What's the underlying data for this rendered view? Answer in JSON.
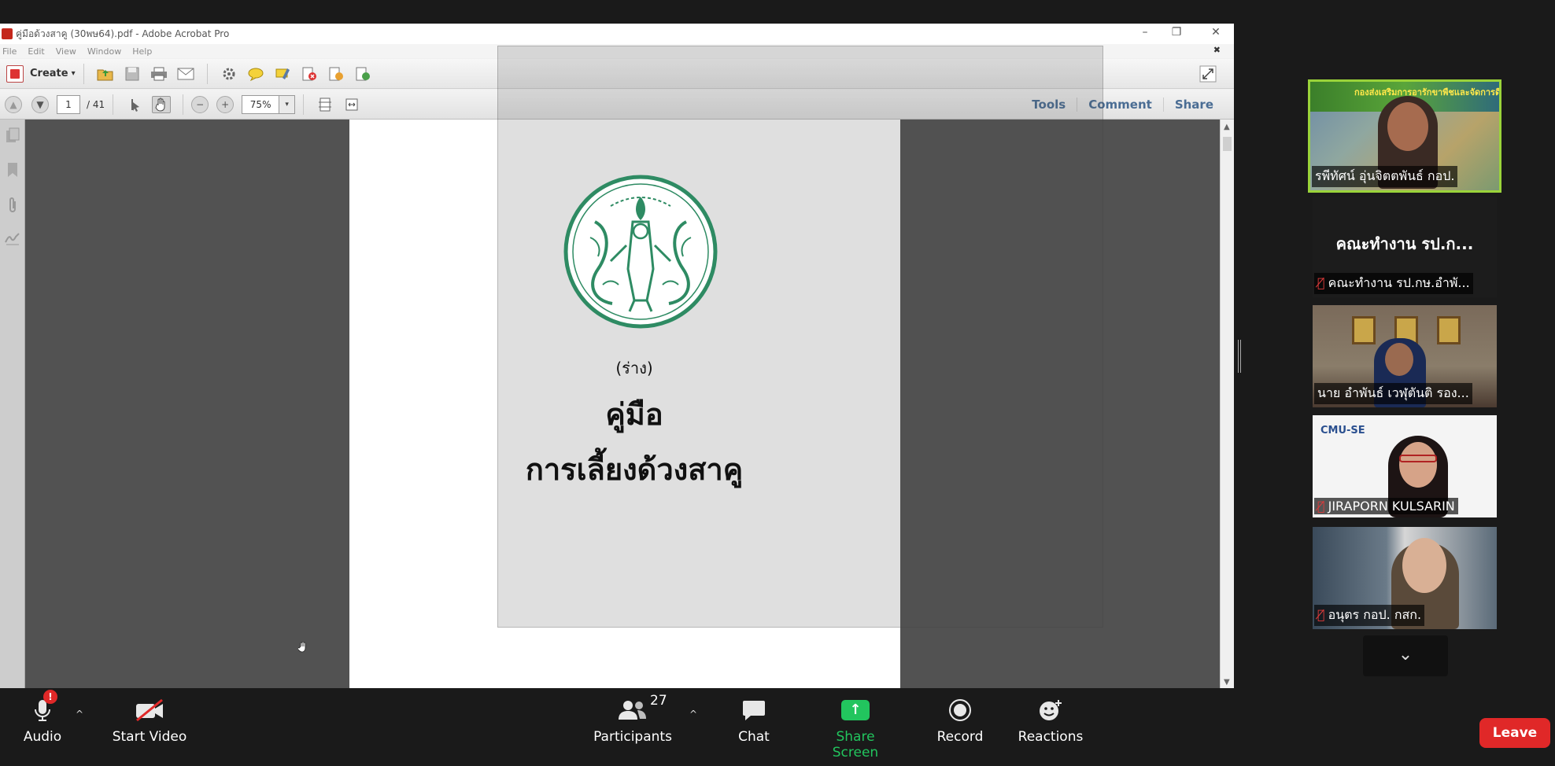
{
  "acrobat": {
    "window_title": "คู่มือด้วงสาคู (30พษ64).pdf - Adobe Acrobat Pro",
    "window_controls": {
      "minimize": "–",
      "restore": "❐",
      "close": "✕"
    },
    "menu": [
      "File",
      "Edit",
      "View",
      "Window",
      "Help"
    ],
    "close_doc": "✖",
    "toolbar": {
      "create_label": "Create",
      "create_caret": "▾"
    },
    "nav": {
      "page_current": "1",
      "page_total": "/ 41",
      "zoom": "75%",
      "zoom_caret": "▾"
    },
    "panels": [
      "Tools",
      "Comment",
      "Share"
    ]
  },
  "document": {
    "draft_label": "(ร่าง)",
    "title_line1": "คู่มือ",
    "title_line2": "การเลี้ยงด้วงสาคู"
  },
  "gallery": {
    "tiles": [
      {
        "name": "รพีทัศน์ อุ่นจิตตพันธ์ กอป.",
        "muted": false,
        "banner_text": "กองส่งเสริมการอารักขาพืชและจัดการดินปุ๋ย",
        "active_speaker": true
      },
      {
        "name": "คณะทำงาน รป.กษ.อำพั...",
        "muted": true,
        "big_name": "คณะทำงาน รป.ก..."
      },
      {
        "name": "นาย อำพันธ์ เวฬุตันติ รอง...",
        "muted": false
      },
      {
        "name": "JIRAPORN KULSARIN",
        "muted": true,
        "logo_text": "CMU-SE"
      },
      {
        "name": "อนุตร กอป. กสก.",
        "muted": true
      }
    ],
    "scroll_down": "⌄"
  },
  "zoom_bar": {
    "audio_label": "Audio",
    "audio_alert": "!",
    "video_label": "Start Video",
    "participants_label": "Participants",
    "participants_count": "27",
    "chat_label": "Chat",
    "share_label": "Share Screen",
    "record_label": "Record",
    "reactions_label": "Reactions",
    "leave_label": "Leave",
    "caret": "^"
  },
  "colors": {
    "share_green": "#22c55e",
    "leave_red": "#e02828",
    "active_speaker_border": "#9ad33a",
    "seal_green": "#2e8b63",
    "acrobat_link_blue": "#4a6d94"
  }
}
